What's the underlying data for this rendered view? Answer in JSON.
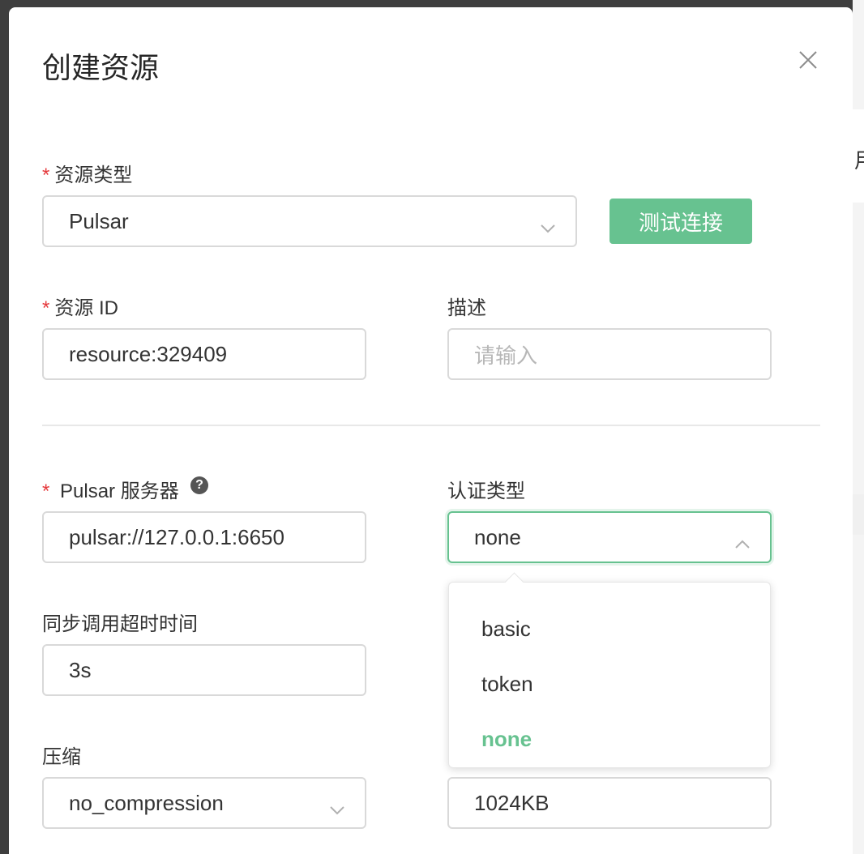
{
  "dialog": {
    "title": "创建资源"
  },
  "background": {
    "partial_text": "用"
  },
  "form": {
    "resource_type": {
      "label": "资源类型",
      "value": "Pulsar"
    },
    "test_button": "测试连接",
    "resource_id": {
      "label": "资源 ID",
      "value": "resource:329409"
    },
    "description": {
      "label": "描述",
      "placeholder": "请输入"
    },
    "pulsar_server": {
      "label": "Pulsar 服务器",
      "value": "pulsar://127.0.0.1:6650",
      "help": "?"
    },
    "auth_type": {
      "label": "认证类型",
      "value": "none",
      "options": [
        {
          "label": "basic"
        },
        {
          "label": "token"
        },
        {
          "label": "none",
          "selected": true
        }
      ]
    },
    "sync_timeout": {
      "label": "同步调用超时时间",
      "value": "3s"
    },
    "compression": {
      "label": "压缩",
      "value": "no_compression"
    },
    "batch_size": {
      "value": "1024KB"
    }
  },
  "colors": {
    "accent": "#67c290",
    "required": "#e5383b"
  }
}
